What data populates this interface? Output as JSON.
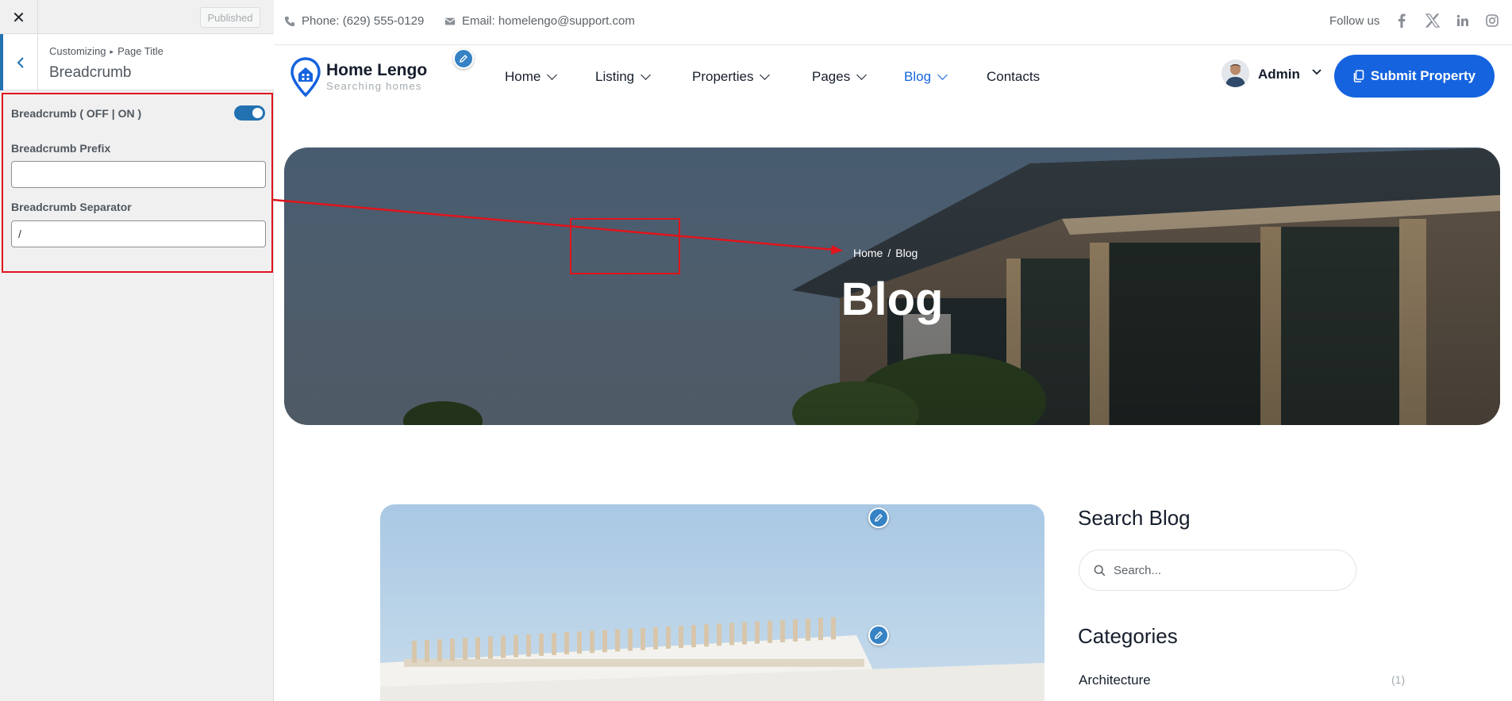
{
  "customizer": {
    "close_icon": "close-icon",
    "publish_label": "Published",
    "breadcrumb_parent": "Customizing",
    "breadcrumb_child": "Page Title",
    "section_title": "Breadcrumb",
    "toggle_label": "Breadcrumb ( OFF | ON )",
    "toggle_on": true,
    "prefix_label": "Breadcrumb Prefix",
    "prefix_value": "",
    "separator_label": "Breadcrumb Separator",
    "separator_value": "/",
    "accent_color": "#2271b1",
    "highlight_color": "#e0141c"
  },
  "topbar": {
    "phone": "Phone: (629) 555-0129",
    "email": "Email: homelengo@support.com",
    "follow_label": "Follow us",
    "social": [
      "facebook-icon",
      "x-icon",
      "linkedin-icon",
      "instagram-icon"
    ]
  },
  "header": {
    "logo_name": "Home Lengo",
    "logo_tagline": "Searching homes",
    "nav": [
      {
        "label": "Home",
        "active": false
      },
      {
        "label": "Listing",
        "active": false
      },
      {
        "label": "Properties",
        "active": false
      },
      {
        "label": "Pages",
        "active": false
      },
      {
        "label": "Blog",
        "active": true
      },
      {
        "label": "Contacts",
        "active": false
      }
    ],
    "user_name": "Admin",
    "submit_label": "Submit Property",
    "brand_color": "#1563df"
  },
  "hero": {
    "crumb_home": "Home",
    "crumb_sep": "/",
    "crumb_current": "Blog",
    "title": "Blog"
  },
  "sidebar_widgets": {
    "search_title": "Search Blog",
    "search_placeholder": "Search...",
    "categories_title": "Categories",
    "categories": [
      {
        "name": "Architecture",
        "count": "(1)"
      }
    ]
  }
}
